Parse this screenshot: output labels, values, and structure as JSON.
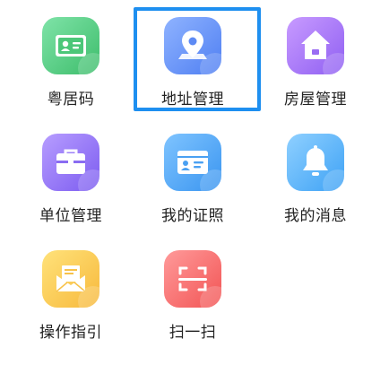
{
  "grid": {
    "items": [
      {
        "label": "粤居码",
        "icon": "id-card-icon",
        "color_from": "#7fe3a8",
        "color_to": "#3dbd6b"
      },
      {
        "label": "地址管理",
        "icon": "location-pin-icon",
        "color_from": "#8fb3ff",
        "color_to": "#4f7ff2"
      },
      {
        "label": "房屋管理",
        "icon": "house-icon",
        "color_from": "#c89bff",
        "color_to": "#8f5ff2"
      },
      {
        "label": "单位管理",
        "icon": "briefcase-icon",
        "color_from": "#b79dff",
        "color_to": "#7c5cf0"
      },
      {
        "label": "我的证照",
        "icon": "license-card-icon",
        "color_from": "#7fc4ff",
        "color_to": "#3a95f0"
      },
      {
        "label": "我的消息",
        "icon": "bell-icon",
        "color_from": "#8fd0ff",
        "color_to": "#3ea2f5"
      },
      {
        "label": "操作指引",
        "icon": "envelope-icon",
        "color_from": "#ffe27a",
        "color_to": "#f7b93c"
      },
      {
        "label": "扫一扫",
        "icon": "scan-icon",
        "color_from": "#ff9a9a",
        "color_to": "#f25454"
      }
    ],
    "selected_index": 1,
    "highlight_color": "#1e8ff0"
  }
}
